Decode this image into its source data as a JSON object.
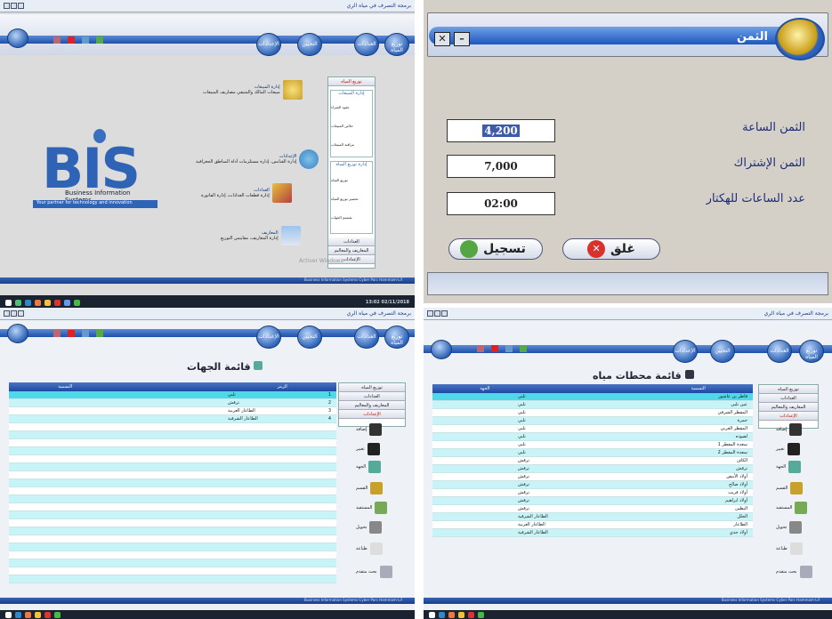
{
  "panel1": {
    "window_title": "برمجة التصرف في مياه الري",
    "toolbar_tabs": [
      "توزيع المياه",
      "العدادات",
      "التحيين",
      "الإعدادات"
    ],
    "nav_groups": {
      "group1_title": "إدارة المبيعات",
      "group1_items": [
        "عقود الشراء",
        "خلاص المبيعات",
        "مراقبة المبيعات"
      ],
      "group2_title": "إدارة توزيع المياه",
      "group2_items": [
        "توزيع المياه",
        "تحضير توزيع المياه",
        "تقسيم الجهات"
      ]
    },
    "nav_bottom": [
      "العدادات",
      "المعاريف والمعاليم",
      "الإعدادات"
    ],
    "nav_header": "توزيع المياه",
    "features": [
      {
        "title": "إدارة المبيعات",
        "desc": "مبيعات المالك والمتبقي مصاريف المبيعات"
      },
      {
        "title": "الإعدادات",
        "desc": "إدارة القنابس، إدارة مستلزمات أداة المناطق الجغرافية"
      },
      {
        "title": "العدادات",
        "desc": "إدارة قطعات العدادات، إدارة الفاتورة"
      },
      {
        "title": "المعاريف",
        "desc": "إدارة المعاريف، مقاييس التوزيع"
      }
    ],
    "logo_text": "BIS",
    "logo_line1": "Business Information Systems",
    "logo_line2": "Your partner for technology and innovation",
    "watermark": "Activer Windows",
    "footer": "Business Information Systems Cyber Parc Hammam-Lif"
  },
  "dialog": {
    "title": "الثمن",
    "fields": [
      {
        "label": "الثمن الساعة",
        "value": "4,200"
      },
      {
        "label": "الثمن الإشتراك",
        "value": "7,000"
      },
      {
        "label": "عدد الساعات للهكتار",
        "value": "02:00"
      }
    ],
    "close_label": "غلق",
    "save_label": "تسجيل",
    "min_glyph": "–",
    "close_glyph": "✕"
  },
  "panel3": {
    "page_title": "قائمة الجهات",
    "columns": [
      "التسمية",
      "الرمز"
    ],
    "rows": [
      {
        "code": "1",
        "name": "تلبي"
      },
      {
        "code": "2",
        "name": "ترقش"
      },
      {
        "code": "3",
        "name": "الطاعار الغربية"
      },
      {
        "code": "4",
        "name": "الطاعار الشرقية"
      }
    ],
    "side_actions": [
      "إضافة",
      "تغيير",
      "الجهة",
      "القسم",
      "المستفيد",
      "تحويل",
      "طباعة",
      "بحث متقدم"
    ]
  },
  "panel4": {
    "page_title": "قائمة محطات مياه",
    "columns": [
      "الجهة",
      "التسمية"
    ],
    "rows": [
      {
        "region": "تلبي",
        "name": "قاطر بن عاشور"
      },
      {
        "region": "تلبي",
        "name": "عين تلبي"
      },
      {
        "region": "تلبي",
        "name": "المقطر الشرقي"
      },
      {
        "region": "تلبي",
        "name": "حمرة"
      },
      {
        "region": "تلبي",
        "name": "المقطر الغربي"
      },
      {
        "region": "تلبي",
        "name": "لصوده"
      },
      {
        "region": "تلبي",
        "name": "سعدة المقطر 1"
      },
      {
        "region": "تلبي",
        "name": "سعدة المقطر 2"
      },
      {
        "region": "ترقش",
        "name": "الكاف"
      },
      {
        "region": "ترقش",
        "name": "ترقش"
      },
      {
        "region": "ترقش",
        "name": "أولاد الأبيض"
      },
      {
        "region": "ترقش",
        "name": "أولاد صالح"
      },
      {
        "region": "ترقش",
        "name": "أولاد قريب"
      },
      {
        "region": "ترقش",
        "name": "أولاد ابراهيم"
      },
      {
        "region": "ترقش",
        "name": "البطين"
      },
      {
        "region": "الطاعار الشرقية",
        "name": "الجلل"
      },
      {
        "region": "الطاعار الغربية",
        "name": "الطاعار"
      },
      {
        "region": "الطاعار الشرقية",
        "name": "أولاد جدي"
      }
    ]
  },
  "taskbar": {
    "time": "13:02",
    "date": "02/11/2018"
  },
  "colors": {
    "accent": "#1f4fa8",
    "row_alt": "#c8f4f7",
    "row_selected": "#4fd9e8"
  }
}
